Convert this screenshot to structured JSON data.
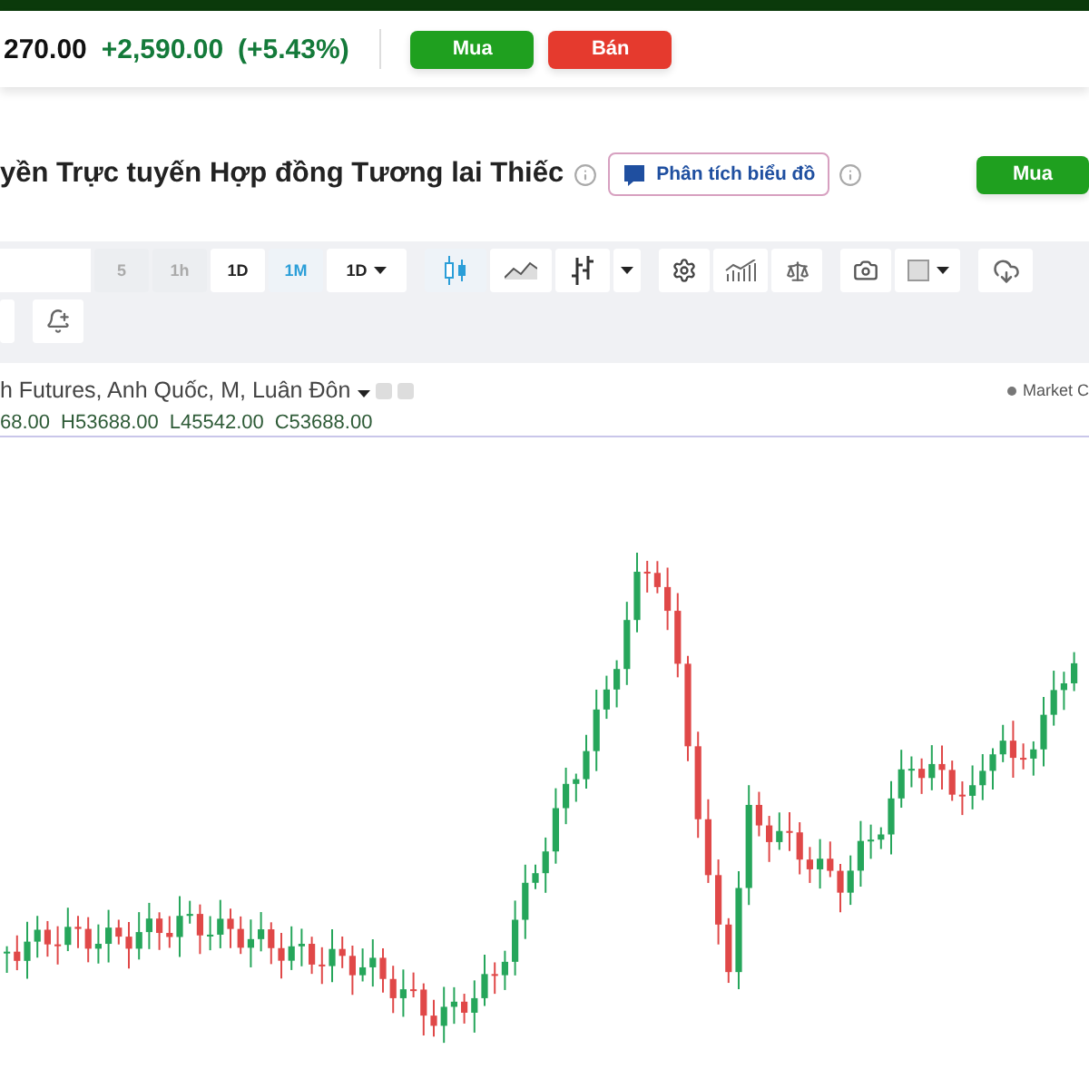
{
  "quote": {
    "price": "270.00",
    "change": "+2,590.00",
    "change_percent": "(+5.43%)",
    "buy": "Mua",
    "sell": "Bán"
  },
  "title": {
    "text": "yền Trực tuyến Hợp đồng Tương lai Thiếc",
    "ai_button": "Phân tích biểu đồ",
    "buy": "Mua"
  },
  "toolbar": {
    "intervals": [
      {
        "label": "5",
        "selected": false,
        "disabled": true
      },
      {
        "label": "1h",
        "selected": false,
        "disabled": true
      },
      {
        "label": "1D",
        "selected": false,
        "disabled": false
      },
      {
        "label": "1M",
        "selected": true,
        "disabled": false
      }
    ],
    "interval_menu": "1D",
    "chart_types": [
      {
        "selected": true
      },
      {
        "selected": false
      },
      {
        "selected": false
      }
    ]
  },
  "legend": {
    "symbol": "h Futures, Anh Quốc, M, Luân Đôn",
    "market_status": "Market C",
    "ohlc": [
      "68.00",
      "H53688.00",
      "L45542.00",
      "C53688.00"
    ]
  }
}
